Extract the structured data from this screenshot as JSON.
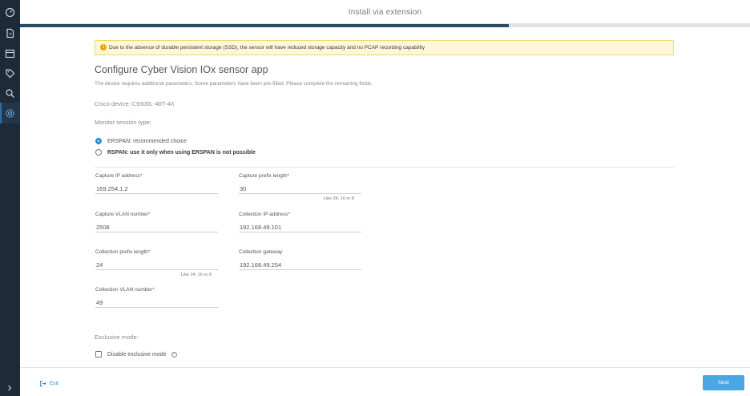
{
  "header": {
    "title": "Install via extension",
    "progress": 0.67
  },
  "sidebar": {
    "items": [
      {
        "icon": "dashboard-icon"
      },
      {
        "icon": "document-icon"
      },
      {
        "icon": "calendar-icon"
      },
      {
        "icon": "tag-icon"
      },
      {
        "icon": "search-icon"
      },
      {
        "icon": "gear-icon",
        "active": true
      }
    ],
    "expand_icon": "chevron-right-icon"
  },
  "warning": {
    "text": "Due to the absence of durable persistent storage (SSD), the sensor will have reduced storage capacity and no PCAP recording capability",
    "icon": "!"
  },
  "page": {
    "title": "Configure Cyber Vision IOx sensor app",
    "description": "The device requires additional parameters. Some parameters have been pre-filled. Please complete the remaining fields.",
    "device": "Cisco device: C9300L-48T-4X",
    "monitor_label": "Monitor session type:",
    "radio_erspan": "ERSPAN: recommended choice",
    "radio_rspan": "RSPAN: use it only when using ERSPAN is not possible"
  },
  "fields": {
    "capture_ip": {
      "label": "Capture IP address",
      "value": "169.254.1.2"
    },
    "capture_prefix": {
      "label": "Capture prefix length",
      "value": "30",
      "hint": "Like 24, 16 or 8"
    },
    "capture_vlan": {
      "label": "Capture VLAN number",
      "value": "2508"
    },
    "collection_ip": {
      "label": "Collection IP address",
      "value": "192.168.49.101"
    },
    "collection_prefix": {
      "label": "Collection prefix length",
      "value": "24",
      "hint": "Like 24, 16 or 8"
    },
    "collection_gateway": {
      "label": "Collection gateway",
      "value": "192.168.49.254"
    },
    "collection_vlan": {
      "label": "Collection VLAN number",
      "value": "49"
    },
    "required_mark": "*"
  },
  "exclusive": {
    "label": "Exclusive mode:",
    "checkbox_label": "Disable exclusive mode",
    "info": "i"
  },
  "footer": {
    "exit_label": "Exit",
    "next_label": "Next"
  }
}
